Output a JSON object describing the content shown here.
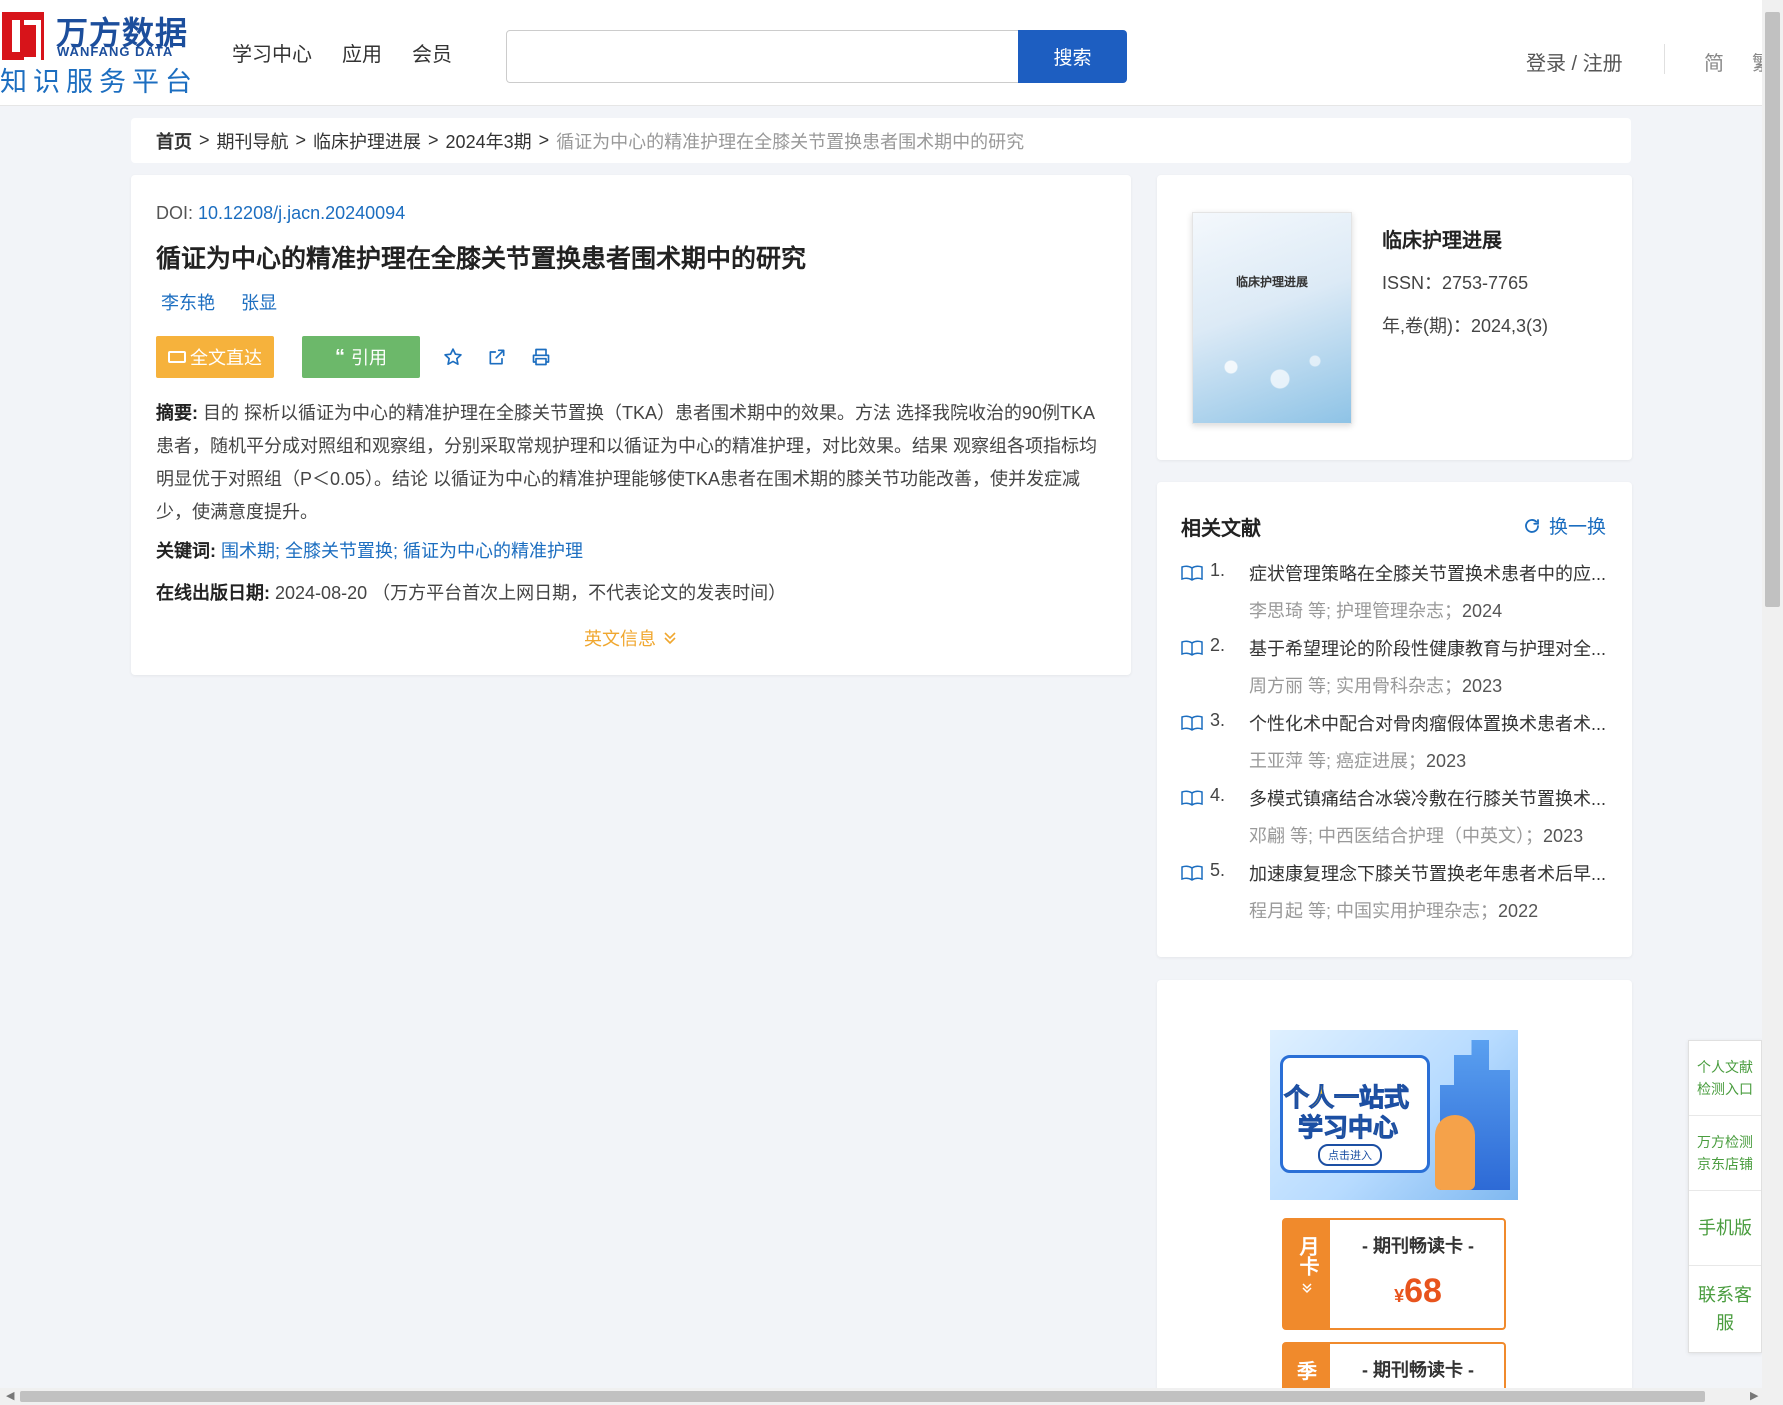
{
  "header": {
    "logo_cn": "万方数据",
    "logo_en": "WANFANG DATA",
    "logo_sub": "知识服务平台",
    "nav": [
      "学习中心",
      "应用",
      "会员"
    ],
    "search_placeholder": "",
    "search_button": "搜索",
    "login": "登录 / 注册",
    "lang": "简",
    "lang2": "繁"
  },
  "breadcrumb": {
    "items": [
      "首页",
      "期刊导航",
      "临床护理进展",
      "2024年3期"
    ],
    "separator": ">",
    "current": "循证为中心的精准护理在全膝关节置换患者围术期中的研究"
  },
  "article": {
    "doi_label": "DOI: ",
    "doi": "10.12208/j.jacn.20240094",
    "title": "循证为中心的精准护理在全膝关节置换患者围术期中的研究",
    "authors": [
      "李东艳",
      "张显"
    ],
    "fulltext_button": "全文直达",
    "cite_button": "引用",
    "abstract_label": "摘要:",
    "abstract": "目的 探析以循证为中心的精准护理在全膝关节置换（TKA）患者围术期中的效果。方法 选择我院收治的90例TKA患者，随机平分成对照组和观察组，分别采取常规护理和以循证为中心的精准护理，对比效果。结果 观察组各项指标均明显优于对照组（P＜0.05）。结论 以循证为中心的精准护理能够使TKA患者在围术期的膝关节功能改善，使并发症减少，使满意度提升。",
    "keywords_label": "关键词:",
    "keywords": [
      "围术期",
      "全膝关节置换",
      "循证为中心的精准护理"
    ],
    "keyword_sep": "; ",
    "pubdate_label": "在线出版日期:",
    "pubdate": "2024-08-20",
    "pubdate_note": "（万方平台首次上网日期，不代表论文的发表时间）",
    "en_info": "英文信息"
  },
  "journal": {
    "cover_title": "临床护理进展",
    "name": "临床护理进展",
    "issn": "ISSN：2753-7765",
    "volume": "年,卷(期)：2024,3(3)"
  },
  "related": {
    "title": "相关文献",
    "refresh": "换一换",
    "items": [
      {
        "num": "1.",
        "title": "症状管理策略在全膝关节置换术患者中的应...",
        "author": "李思琦",
        "etal": "等;",
        "source": "护理管理杂志",
        "year": "2024"
      },
      {
        "num": "2.",
        "title": "基于希望理论的阶段性健康教育与护理对全...",
        "author": "周方丽",
        "etal": "等;",
        "source": "实用骨科杂志",
        "year": "2023"
      },
      {
        "num": "3.",
        "title": "个性化术中配合对骨肉瘤假体置换术患者术...",
        "author": "王亚萍",
        "etal": "等;",
        "source": "癌症进展",
        "year": "2023"
      },
      {
        "num": "4.",
        "title": "多模式镇痛结合冰袋冷敷在行膝关节置换术...",
        "author": "邓翩",
        "etal": "等;",
        "source": "中西医结合护理（中英文）",
        "year": "2023"
      },
      {
        "num": "5.",
        "title": "加速康复理念下膝关节置换老年患者术后早...",
        "author": "程月起",
        "etal": "等;",
        "source": "中国实用护理杂志",
        "year": "2022"
      }
    ]
  },
  "promo": {
    "banner_line1": "个人一站式",
    "banner_line2": "学习中心",
    "banner_cta": "点击进入",
    "card1": {
      "side": "月卡",
      "title": "- 期刊畅读卡 -",
      "currency": "¥",
      "price": "68"
    },
    "card2": {
      "side": "季",
      "title": "- 期刊畅读卡 -"
    }
  },
  "float_side": [
    "个人文献检测入口",
    "万方检测京东店铺",
    "手机版",
    "联系客服"
  ]
}
